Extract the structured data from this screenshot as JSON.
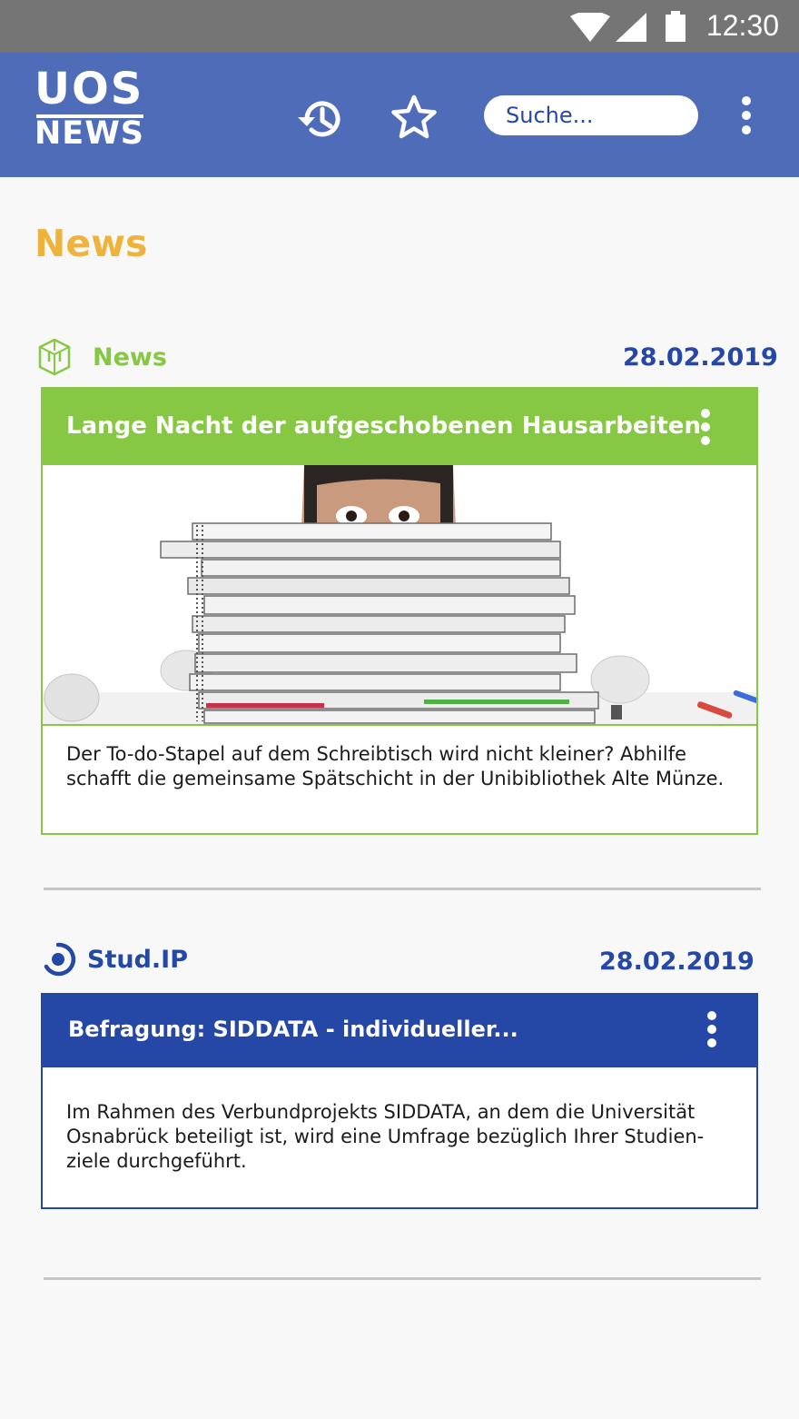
{
  "status_bar": {
    "time": "12:30"
  },
  "app_bar": {
    "logo_top": "UOS",
    "logo_bottom": "NEWS",
    "search_placeholder": "Suche..."
  },
  "page": {
    "title": "News"
  },
  "news_items": [
    {
      "source": "News",
      "date": "28.02.2019",
      "title": "Lange Nacht der aufgeschobenen Hausarbeiten",
      "body": "Der To-do-Stapel auf dem Schreibtisch wird nicht kleiner? Abhilfe schafft die gemeinsame Spätschicht in der Unibibliothek Alte Münze.",
      "accent": "#86c843"
    },
    {
      "source": "Stud.IP",
      "date": "28.02.2019",
      "title": "Befragung: SIDDATA - individueller...",
      "body": "Im Rahmen des Verbundprojekts SIDDATA, an dem die Universität Osnabrück beteiligt ist, wird eine Umfrage bezüglich Ihrer Studien-ziele durchgeführt.",
      "accent": "#2547a5"
    }
  ],
  "colors": {
    "app_bar": "#4f6cb8",
    "title": "#efb33b",
    "date": "#2547a5"
  }
}
